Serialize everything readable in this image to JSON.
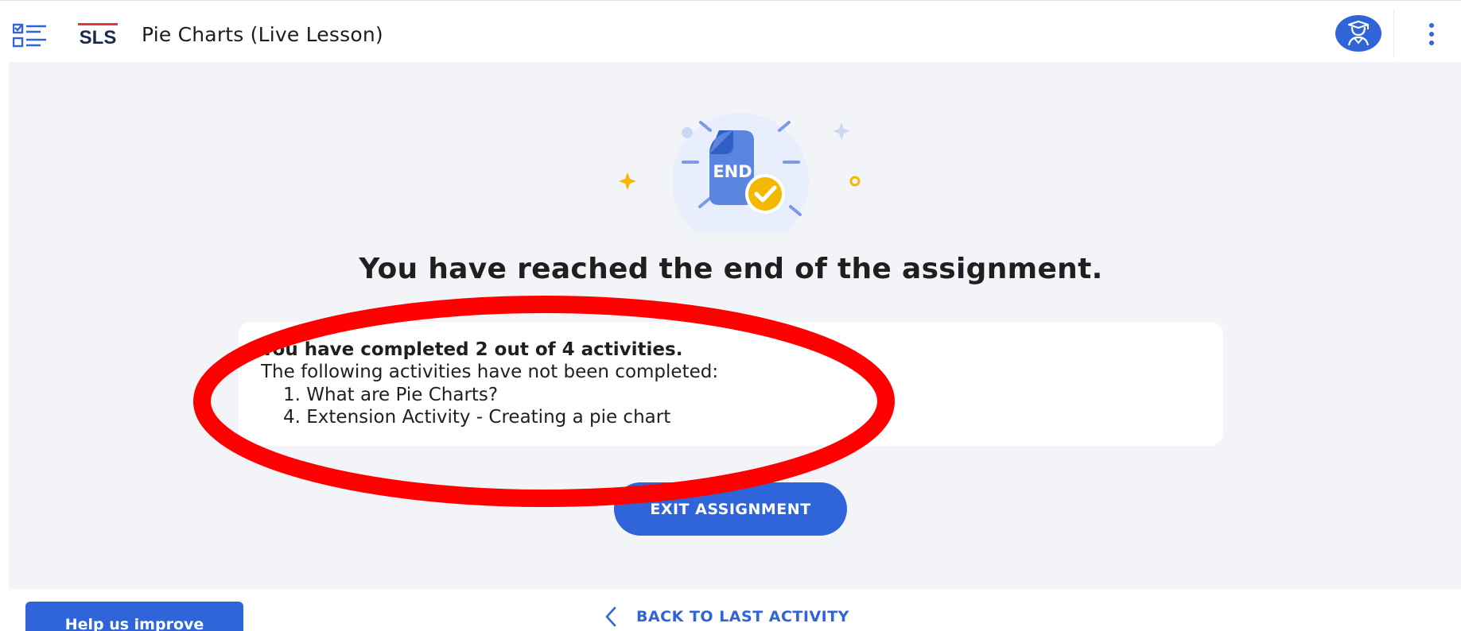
{
  "header": {
    "logo_text": "SLS",
    "title": "Pie Charts (Live Lesson)"
  },
  "illustration": {
    "badge_text": "END"
  },
  "main": {
    "heading": "You have reached the end of the assignment.",
    "summary": "You have completed 2 out of 4 activities.",
    "incomplete_note": "The following activities have not been completed:",
    "incomplete_activities": [
      "1. What are Pie Charts?",
      "4. Extension Activity - Creating a pie chart"
    ],
    "exit_button": "EXIT ASSIGNMENT"
  },
  "footer": {
    "help_button": "Help us improve",
    "back_link": "BACK TO LAST ACTIVITY"
  },
  "colors": {
    "primary": "#2f65d8",
    "background": "#f3f4f8",
    "annotation": "#ff0000",
    "check_badge": "#f5b800",
    "logo_red": "#e53935",
    "logo_navy": "#1b2a4a"
  },
  "icons": {
    "menu": "checklist-menu-icon",
    "avatar": "student-avatar-icon",
    "more": "more-vertical-icon",
    "back": "chevron-left-icon",
    "complete": "check-circle-icon"
  }
}
